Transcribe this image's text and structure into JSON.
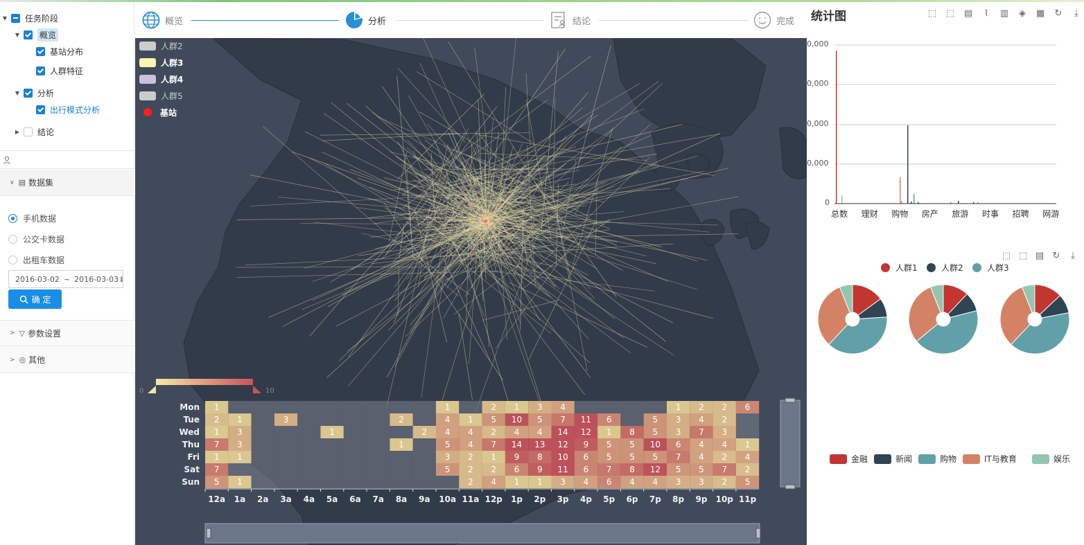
{
  "tree": {
    "root_label": "任务阶段",
    "overview_label": "概览",
    "station_dist_label": "基站分布",
    "crowd_feature_label": "人群特征",
    "analysis_label": "分析",
    "travel_mode_label": "出行模式分析",
    "conclusion_label": "结论"
  },
  "search": {
    "placeholder": ""
  },
  "dataset": {
    "header": "数据集",
    "options": [
      "手机数据",
      "公交卡数据",
      "出租车数据"
    ],
    "selected": "手机数据",
    "date_start": "2016-03-02",
    "date_sep": "~",
    "date_end": "2016-03-03",
    "confirm_label": "确 定"
  },
  "params_header": "参数设置",
  "other_header": "其他",
  "stepper": {
    "steps": [
      {
        "label": "概览",
        "icon": "globe-icon"
      },
      {
        "label": "分析",
        "icon": "pie-chart-icon"
      },
      {
        "label": "结论",
        "icon": "report-icon"
      },
      {
        "label": "完成",
        "icon": "smile-icon"
      }
    ],
    "active": "分析"
  },
  "map": {
    "legend": [
      {
        "label": "人群2",
        "color": "#cccccc",
        "style": "dim"
      },
      {
        "label": "人群3",
        "color": "#fff5b0",
        "style": "bold"
      },
      {
        "label": "人群4",
        "color": "#c8c2dc",
        "style": "bold"
      },
      {
        "label": "人群5",
        "color": "#cccccc",
        "style": "dim"
      },
      {
        "label": "基站",
        "color": "#ff1e1e",
        "style": "bold"
      }
    ],
    "visualmap": {
      "min_label": "0",
      "max_label": "10"
    }
  },
  "heatmap": {
    "days": [
      "Mon",
      "Tue",
      "Wed",
      "Thu",
      "Fri",
      "Sat",
      "Sun"
    ],
    "hours": [
      "12a",
      "1a",
      "2a",
      "3a",
      "4a",
      "5a",
      "6a",
      "7a",
      "8a",
      "9a",
      "10a",
      "11a",
      "12p",
      "1p",
      "2p",
      "3p",
      "4p",
      "5p",
      "6p",
      "7p",
      "8p",
      "9p",
      "10p",
      "11p"
    ],
    "values": [
      [
        1,
        null,
        null,
        null,
        null,
        null,
        null,
        null,
        null,
        null,
        1,
        null,
        2,
        1,
        3,
        4,
        null,
        null,
        null,
        null,
        1,
        2,
        2,
        6
      ],
      [
        2,
        1,
        null,
        3,
        null,
        null,
        null,
        null,
        2,
        null,
        4,
        1,
        5,
        10,
        5,
        7,
        11,
        6,
        null,
        5,
        3,
        4,
        2,
        null
      ],
      [
        1,
        3,
        null,
        null,
        null,
        1,
        null,
        null,
        null,
        2,
        4,
        4,
        2,
        4,
        4,
        14,
        12,
        1,
        8,
        5,
        3,
        7,
        3,
        null
      ],
      [
        7,
        3,
        null,
        null,
        null,
        null,
        null,
        null,
        1,
        null,
        5,
        4,
        7,
        14,
        13,
        12,
        9,
        5,
        5,
        10,
        6,
        4,
        4,
        1
      ],
      [
        1,
        1,
        null,
        null,
        null,
        null,
        null,
        null,
        null,
        null,
        3,
        2,
        1,
        9,
        8,
        10,
        6,
        5,
        5,
        5,
        7,
        4,
        2,
        4
      ],
      [
        7,
        null,
        null,
        null,
        null,
        null,
        null,
        null,
        null,
        null,
        5,
        2,
        2,
        6,
        9,
        11,
        6,
        7,
        8,
        12,
        5,
        5,
        7,
        2
      ],
      [
        5,
        1,
        null,
        null,
        null,
        null,
        null,
        null,
        null,
        null,
        null,
        2,
        4,
        1,
        1,
        3,
        4,
        6,
        4,
        4,
        3,
        3,
        2,
        5
      ]
    ]
  },
  "right": {
    "title": "统计图",
    "toolbar_icons": [
      "zoom-icon",
      "zoom-reset-icon",
      "data-view-icon",
      "line-type-icon",
      "bar-type-icon",
      "stack-type-icon",
      "tiled-type-icon",
      "restore-icon",
      "save-image-icon"
    ],
    "pie_toolbar_icons": [
      "zoom-icon",
      "zoom-reset-icon",
      "data-view-icon",
      "restore-icon",
      "save-image-icon"
    ],
    "bar_chart": {
      "y_ticks": [
        "0",
        "0,000",
        "0,000",
        "0,000",
        "0,000"
      ],
      "x_labels": [
        "总数",
        "理财",
        "购物",
        "房产",
        "旅游",
        "时事",
        "招聘",
        "网游"
      ]
    },
    "pie_legend": [
      {
        "label": "人群1",
        "color": "#c23531"
      },
      {
        "label": "人群2",
        "color": "#2f4554"
      },
      {
        "label": "人群3",
        "color": "#61a0a8"
      }
    ],
    "category_legend": [
      {
        "label": "金融",
        "color": "#c23531"
      },
      {
        "label": "新闻",
        "color": "#2f4554"
      },
      {
        "label": "购物",
        "color": "#61a0a8"
      },
      {
        "label": "IT与教育",
        "color": "#d48265"
      },
      {
        "label": "娱乐",
        "color": "#91c7ae"
      }
    ]
  }
}
